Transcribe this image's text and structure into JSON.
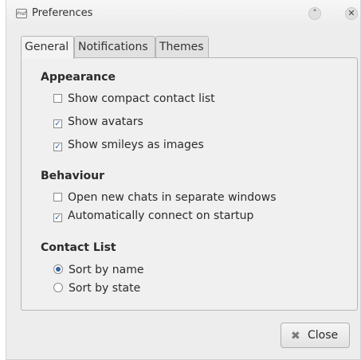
{
  "window": {
    "title": "Preferences",
    "app_icon": "preferences-icon",
    "app_icon_text": "Pref",
    "minimize_glyph": "˄",
    "close_glyph": "✕"
  },
  "tabs": [
    {
      "label": "General",
      "active": true
    },
    {
      "label": "Notifications",
      "active": false
    },
    {
      "label": "Themes",
      "active": false
    }
  ],
  "appearance": {
    "title": "Appearance",
    "options": [
      {
        "label": "Show compact contact list",
        "checked": false
      },
      {
        "label": "Show avatars",
        "checked": true
      },
      {
        "label": "Show smileys as images",
        "checked": true
      }
    ]
  },
  "behaviour": {
    "title": "Behaviour",
    "options": [
      {
        "label": "Open new chats in separate windows",
        "checked": false
      },
      {
        "label": "Automatically connect on startup",
        "checked": true
      }
    ]
  },
  "contact_list": {
    "title": "Contact List",
    "options": [
      {
        "label": "Sort by name",
        "selected": true
      },
      {
        "label": "Sort by state",
        "selected": false
      }
    ]
  },
  "footer": {
    "close_label": "Close",
    "check_glyph": "✓"
  },
  "colors": {
    "accent": "#3465a4",
    "window_bg": "#ededed"
  }
}
